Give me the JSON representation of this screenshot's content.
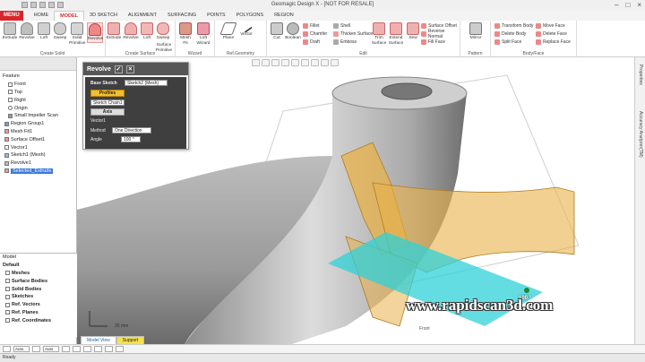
{
  "app": {
    "title": "Geomagic Design X - [NOT FOR RESALE]"
  },
  "menu": {
    "menu_label": "MENU",
    "tabs": [
      "HOME",
      "MODEL",
      "3D SKETCH",
      "ALIGNMENT",
      "SURFACING",
      "POINTS",
      "POLYGONS",
      "REGION"
    ],
    "active_tab": "MODEL"
  },
  "ribbon": {
    "create_solid": {
      "label": "Create Solid",
      "buttons": [
        "Extrude",
        "Revolve",
        "Loft",
        "Sweep",
        "Solid Primitive",
        "Revolve"
      ]
    },
    "create_surface": {
      "label": "Create Surface",
      "buttons": [
        "Extrude",
        "Revolve",
        "Loft",
        "Sweep",
        "Surface Primitive"
      ]
    },
    "wizard": {
      "label": "Wizard",
      "buttons": [
        "Mesh Fit",
        "Loft Wizard"
      ]
    },
    "refgeometry": {
      "label": "Ref.Geometry",
      "buttons": [
        "Plane",
        "Vector"
      ]
    },
    "edit": {
      "label": "Edit",
      "buttons": [
        "Cut",
        "Boolean"
      ],
      "small": [
        "Fillet",
        "Chamfer",
        "Draft",
        "Shell",
        "Thicken Surface",
        "Emboss",
        "Trim Surface",
        "Extend Surface",
        "Sew",
        "Surface Offset",
        "Reverse Normal",
        "Fill Face"
      ]
    },
    "pattern": {
      "label": "Pattern",
      "buttons": [
        "Mirror"
      ]
    },
    "bodyface": {
      "label": "Body/Face",
      "small": [
        "Transform Body",
        "Delete Body",
        "Split Face",
        "Move Face",
        "Delete Face",
        "Replace Face"
      ]
    }
  },
  "feature_tree": {
    "header": "Feature",
    "items": [
      {
        "label": "Front"
      },
      {
        "label": "Top"
      },
      {
        "label": "Right"
      },
      {
        "label": "Origin"
      },
      {
        "label": "Small Impeller Scan"
      },
      {
        "label": "Region Group1"
      },
      {
        "label": "Mesh Fit1"
      },
      {
        "label": "Surface Offset1"
      },
      {
        "label": "Vector1"
      },
      {
        "label": "Sketch1 (Mesh)"
      },
      {
        "label": "Revolve1"
      },
      {
        "label": "Selected_Extrude"
      }
    ]
  },
  "model_tree": {
    "header": "Model",
    "root": "Default",
    "items": [
      "Meshes",
      "Surface Bodies",
      "Solid Bodies",
      "Sketches",
      "Ref. Vectors",
      "Ref. Planes",
      "Ref. Coordinates"
    ]
  },
  "dialog": {
    "title": "Revolve",
    "base_sketch_label": "Base Sketch",
    "base_sketch_value": "Sketch2 (Mesh)",
    "profiles_label": "Profiles",
    "profile_value": "Sketch Chain1",
    "axis_label": "Axis",
    "axis_value": "Vector1",
    "method_label": "Method",
    "method_value": "One Direction",
    "angle_label": "Angle",
    "angle_value": "100 °"
  },
  "viewport": {
    "angle_overlay": "100 °",
    "scale_text": "25 mm",
    "watermark": "www.rapidscan3d.com",
    "footer_text": "Front"
  },
  "bottom": {
    "view_tabs": [
      "Model View",
      "Support"
    ],
    "status": "Ready",
    "auto_label": "Auto"
  },
  "right_strip": [
    "Properties",
    "Accuracy Analyzer(TM)"
  ],
  "colors": {
    "accent_red": "#d9262b",
    "surface_orange": "#e8b14a",
    "plane_cyan": "#2fd1d8",
    "dialog_dark": "#3f3f3f",
    "gray_body": "#b5b5b5"
  }
}
